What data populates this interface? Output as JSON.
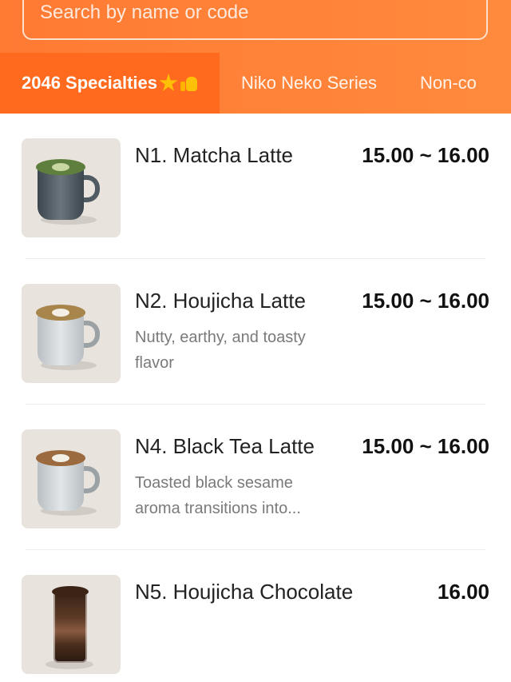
{
  "search": {
    "placeholder": "Search by name or code"
  },
  "tabs": [
    {
      "label": "2046 Specialties",
      "active": true,
      "icons": [
        "star-icon",
        "thumbs-up-icon"
      ]
    },
    {
      "label": "Niko Neko Series",
      "active": false
    },
    {
      "label": "Non-co",
      "active": false
    }
  ],
  "colors": {
    "header": "#ff7a33",
    "active_tab": "#ff6a1e",
    "star": "#ffc107"
  },
  "menu": {
    "items": [
      {
        "name": "N1. Matcha Latte",
        "price": "15.00 ~ 16.00",
        "desc": "",
        "image": "matcha-latte-mug"
      },
      {
        "name": "N2. Houjicha Latte",
        "price": "15.00 ~ 16.00",
        "desc": "Nutty, earthy, and toasty flavor",
        "image": "houjicha-latte-mug"
      },
      {
        "name": "N4. Black Tea Latte",
        "price": "15.00 ~ 16.00",
        "desc": "Toasted black sesame aroma transitions into...",
        "image": "black-tea-latte-mug"
      },
      {
        "name": "N5. Houjicha Chocolate",
        "price": "16.00",
        "desc": "",
        "image": "houjicha-chocolate-glass"
      }
    ]
  }
}
